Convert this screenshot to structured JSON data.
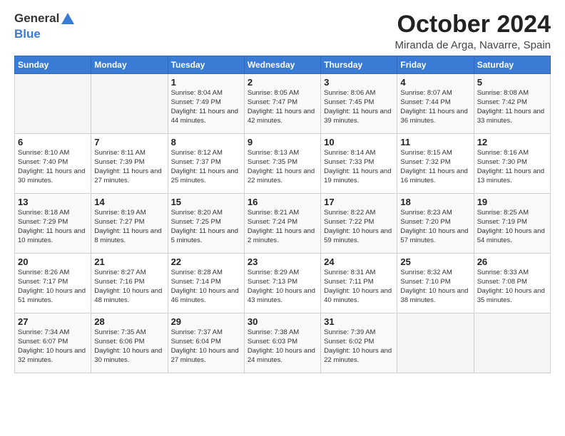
{
  "logo": {
    "text_general": "General",
    "text_blue": "Blue"
  },
  "title": "October 2024",
  "location": "Miranda de Arga, Navarre, Spain",
  "days_of_week": [
    "Sunday",
    "Monday",
    "Tuesday",
    "Wednesday",
    "Thursday",
    "Friday",
    "Saturday"
  ],
  "weeks": [
    [
      {
        "day": "",
        "info": ""
      },
      {
        "day": "",
        "info": ""
      },
      {
        "day": "1",
        "info": "Sunrise: 8:04 AM\nSunset: 7:49 PM\nDaylight: 11 hours and 44 minutes."
      },
      {
        "day": "2",
        "info": "Sunrise: 8:05 AM\nSunset: 7:47 PM\nDaylight: 11 hours and 42 minutes."
      },
      {
        "day": "3",
        "info": "Sunrise: 8:06 AM\nSunset: 7:45 PM\nDaylight: 11 hours and 39 minutes."
      },
      {
        "day": "4",
        "info": "Sunrise: 8:07 AM\nSunset: 7:44 PM\nDaylight: 11 hours and 36 minutes."
      },
      {
        "day": "5",
        "info": "Sunrise: 8:08 AM\nSunset: 7:42 PM\nDaylight: 11 hours and 33 minutes."
      }
    ],
    [
      {
        "day": "6",
        "info": "Sunrise: 8:10 AM\nSunset: 7:40 PM\nDaylight: 11 hours and 30 minutes."
      },
      {
        "day": "7",
        "info": "Sunrise: 8:11 AM\nSunset: 7:39 PM\nDaylight: 11 hours and 27 minutes."
      },
      {
        "day": "8",
        "info": "Sunrise: 8:12 AM\nSunset: 7:37 PM\nDaylight: 11 hours and 25 minutes."
      },
      {
        "day": "9",
        "info": "Sunrise: 8:13 AM\nSunset: 7:35 PM\nDaylight: 11 hours and 22 minutes."
      },
      {
        "day": "10",
        "info": "Sunrise: 8:14 AM\nSunset: 7:33 PM\nDaylight: 11 hours and 19 minutes."
      },
      {
        "day": "11",
        "info": "Sunrise: 8:15 AM\nSunset: 7:32 PM\nDaylight: 11 hours and 16 minutes."
      },
      {
        "day": "12",
        "info": "Sunrise: 8:16 AM\nSunset: 7:30 PM\nDaylight: 11 hours and 13 minutes."
      }
    ],
    [
      {
        "day": "13",
        "info": "Sunrise: 8:18 AM\nSunset: 7:29 PM\nDaylight: 11 hours and 10 minutes."
      },
      {
        "day": "14",
        "info": "Sunrise: 8:19 AM\nSunset: 7:27 PM\nDaylight: 11 hours and 8 minutes."
      },
      {
        "day": "15",
        "info": "Sunrise: 8:20 AM\nSunset: 7:25 PM\nDaylight: 11 hours and 5 minutes."
      },
      {
        "day": "16",
        "info": "Sunrise: 8:21 AM\nSunset: 7:24 PM\nDaylight: 11 hours and 2 minutes."
      },
      {
        "day": "17",
        "info": "Sunrise: 8:22 AM\nSunset: 7:22 PM\nDaylight: 10 hours and 59 minutes."
      },
      {
        "day": "18",
        "info": "Sunrise: 8:23 AM\nSunset: 7:20 PM\nDaylight: 10 hours and 57 minutes."
      },
      {
        "day": "19",
        "info": "Sunrise: 8:25 AM\nSunset: 7:19 PM\nDaylight: 10 hours and 54 minutes."
      }
    ],
    [
      {
        "day": "20",
        "info": "Sunrise: 8:26 AM\nSunset: 7:17 PM\nDaylight: 10 hours and 51 minutes."
      },
      {
        "day": "21",
        "info": "Sunrise: 8:27 AM\nSunset: 7:16 PM\nDaylight: 10 hours and 48 minutes."
      },
      {
        "day": "22",
        "info": "Sunrise: 8:28 AM\nSunset: 7:14 PM\nDaylight: 10 hours and 46 minutes."
      },
      {
        "day": "23",
        "info": "Sunrise: 8:29 AM\nSunset: 7:13 PM\nDaylight: 10 hours and 43 minutes."
      },
      {
        "day": "24",
        "info": "Sunrise: 8:31 AM\nSunset: 7:11 PM\nDaylight: 10 hours and 40 minutes."
      },
      {
        "day": "25",
        "info": "Sunrise: 8:32 AM\nSunset: 7:10 PM\nDaylight: 10 hours and 38 minutes."
      },
      {
        "day": "26",
        "info": "Sunrise: 8:33 AM\nSunset: 7:08 PM\nDaylight: 10 hours and 35 minutes."
      }
    ],
    [
      {
        "day": "27",
        "info": "Sunrise: 7:34 AM\nSunset: 6:07 PM\nDaylight: 10 hours and 32 minutes."
      },
      {
        "day": "28",
        "info": "Sunrise: 7:35 AM\nSunset: 6:06 PM\nDaylight: 10 hours and 30 minutes."
      },
      {
        "day": "29",
        "info": "Sunrise: 7:37 AM\nSunset: 6:04 PM\nDaylight: 10 hours and 27 minutes."
      },
      {
        "day": "30",
        "info": "Sunrise: 7:38 AM\nSunset: 6:03 PM\nDaylight: 10 hours and 24 minutes."
      },
      {
        "day": "31",
        "info": "Sunrise: 7:39 AM\nSunset: 6:02 PM\nDaylight: 10 hours and 22 minutes."
      },
      {
        "day": "",
        "info": ""
      },
      {
        "day": "",
        "info": ""
      }
    ]
  ]
}
